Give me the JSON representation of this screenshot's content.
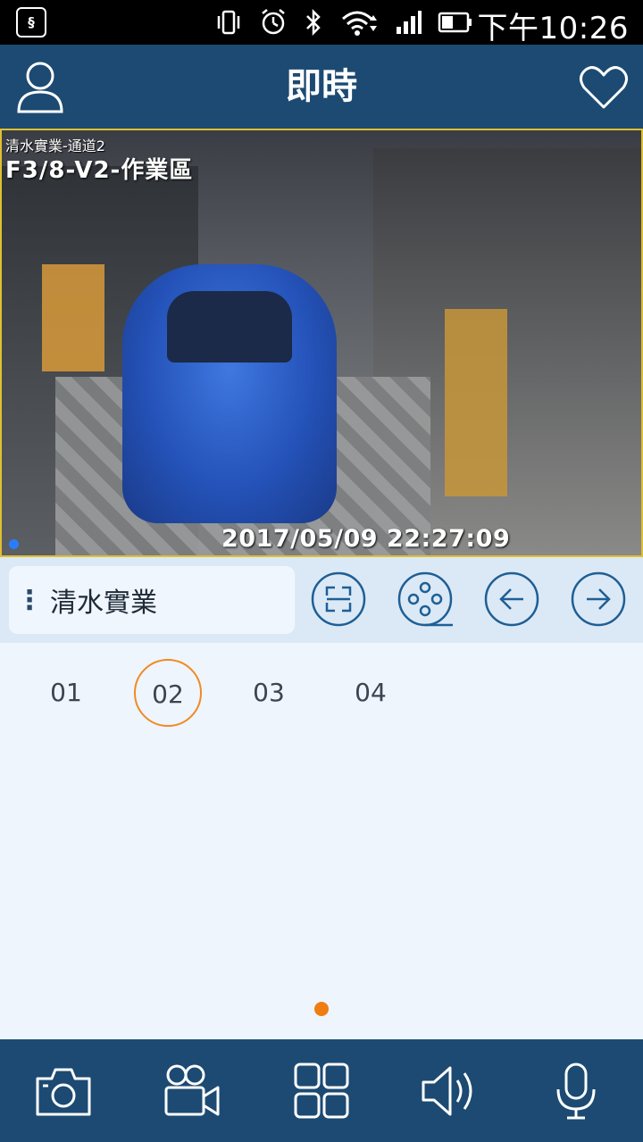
{
  "status_bar": {
    "time": "下午10:26",
    "icons": [
      "app-notification-icon",
      "vibrate-icon",
      "alarm-icon",
      "bluetooth-icon",
      "wifi-icon",
      "signal-icon",
      "battery-icon"
    ]
  },
  "header": {
    "title": "即時",
    "left_icon": "user-icon",
    "right_icon": "heart-icon"
  },
  "video": {
    "camera_label": "清水實業-通道2",
    "zone_label": "F3/8-V2-作業區",
    "timestamp": "2017/05/09 22:27:09"
  },
  "toolbar": {
    "device_name": "清水實業",
    "buttons": [
      "scan-icon",
      "film-reel-icon",
      "arrow-left-icon",
      "arrow-right-icon"
    ]
  },
  "channels": {
    "items": [
      "01",
      "02",
      "03",
      "04"
    ],
    "selected": "02"
  },
  "bottom_bar": {
    "buttons": [
      "camera-icon",
      "video-camera-icon",
      "grid-layout-icon",
      "speaker-icon",
      "microphone-icon"
    ]
  },
  "colors": {
    "header_bg": "#1c4a72",
    "accent": "#f07d10",
    "page_bg": "#eef5fc"
  }
}
